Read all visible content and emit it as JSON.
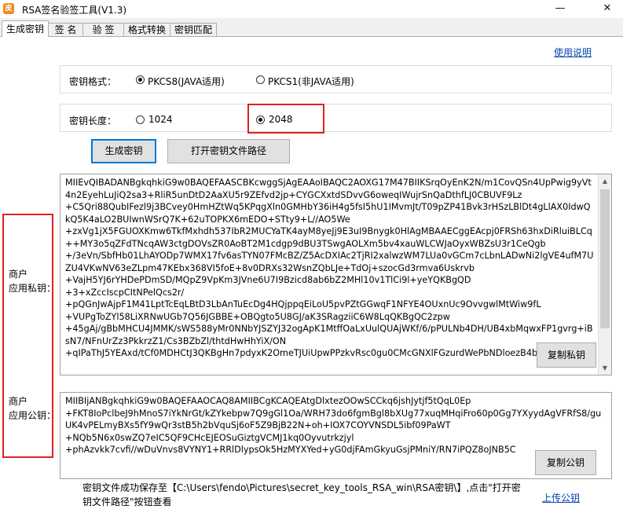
{
  "window": {
    "title": "RSA签名验签工具(V1.3)",
    "app_icon_glyph": "皮",
    "minimize_glyph": "—",
    "close_glyph": "✕"
  },
  "tabs": [
    {
      "label": "生成密钥",
      "active": true
    },
    {
      "label": "签 名",
      "active": false
    },
    {
      "label": "验 签",
      "active": false
    },
    {
      "label": "格式转换",
      "active": false
    },
    {
      "label": "密钥匹配",
      "active": false
    }
  ],
  "help_link": "使用说明",
  "key_format": {
    "label": "密钥格式：",
    "options": [
      {
        "label": "PKCS8(JAVA适用)",
        "checked": true
      },
      {
        "label": "PKCS1(非JAVA适用)",
        "checked": false
      }
    ]
  },
  "key_length": {
    "label": "密钥长度：",
    "options": [
      {
        "label": "1024",
        "checked": false
      },
      {
        "label": "2048",
        "checked": true
      }
    ]
  },
  "buttons": {
    "generate": "生成密钥",
    "open_path": "打开密钥文件路径",
    "copy_private": "复制私钥",
    "copy_public": "复制公钥"
  },
  "private_key": {
    "side_label_line1": "商户",
    "side_label_line2": "应用私钥：",
    "text": "MIIEvQIBADANBgkqhkiG9w0BAQEFAASCBKcwggSjAgEAAoIBAQC2AOXG17M47BIIKSrqOyEnK2N/m1CovQSn4UpPwig9yVt4n2EyehLuJiQ2sa3+RliR5unDtD2AaXU5r9ZEfvd2jp+CYGCXxtdSDvvG6oweqIWujrSnQaDthfLJ0CBUVF9Lz\n+C5Qri88QubIFezl9j3BCvey0HmHZtWq5KPqgXln0GMHbY36iH4g5fsI5hU1IMvmJt/T09pZP41Bvk3rHSzLBlDt4gLlAX0IdwQkQ5K4aLO2BUIwnWSrQ7K+62uTOPKX6mEDO+STty9+L//AO5We\n+zxVg1jX5FGUOXKmw6TkfMxhdh537IbR2MUCYaTK4ayM8yeJj9E3uI9Bnygk0HlAgMBAAECggEAcpj0FRSh63hxDiRluiBLCq++MY3o5qZFdTNcqAW3ctgDOVsZR0AoBT2M1cdgp9dBU3TSwgAOLXm5bv4xauWLCWJaOyxWBZsU3r1CeQgb\n+/3eVn/SbfHb01LhAYODp7WMX17fv6asTYN07FMcBZ/Z5AcDXIAc2TjRI2xalwzWM7LUa0vGCm7cLbnLADwNi2lgVE4ufM7UZU4VKwNV63eZLpm47KEbx368VI5foE+8v0DRXs32WsnZQbLJe+TdOj+szocGd3rmva6Uskrvb\n+VajH5YJ6rYHDePDmSD/MQpZ9VpKm3JVne6U7I9Bzicd8ab6bZ2MHl10v1TlCi9l+yeYQKBgQD\n+3+xZccIscpCItNPelQcs2r/\n+pQGnJwAjpF1M41LptTcEqLBtD3LbAnTuEcDg4HQjppqEiLoU5pvPZtGGwqF1NFYE4OUxnUc9OvvgwlMtWiw9fL\n+VUPgToZYl58LiXRNwUGb7Q56JGBBE+OBQgto5U8GJ/aK3SRagziiC6W8LqQKBgQC2zpw\n+45gAj/gBbMHCU4JMMK/sWS588yMr0NNbYJSZYJ32ogApK1MtffOaLxUulQUAjWKf/6/pPULNb4DH/UB4xbMqwxFP1gvrg+iBsN7/NFnUrZz3PkkrzZ1/Cs3BZbZl/thtdHwHhYiX/ON\n+qIPaThJ5YEAxd/tCf0MDHCtJ3QKBgHn7pdyxK2OmeTJUiUpwPPzkvRsc0gu0CMcGNXlFGzurdWePbNDloezB4bG7G8"
  },
  "public_key": {
    "side_label_line1": "商户",
    "side_label_line2": "应用公钥：",
    "text": "MIIBIjANBgkqhkiG9w0BAQEFAAOCAQ8AMIIBCgKCAQEAtgDlxtezOOwSCCkq6jshJytjf5tQqL0Ep\n+FKT8IoPclbeJ9hMnoS7iYkNrGt/kZYkebpw7Q9gGl1Oa/WRH73do6fgmBgl8bXUg77xuqMHqiFro60p0Gg7YXyydAgVFRfS8/guUK4vPELmyBXs5fY9wQr3stB5h2bVquSj6oF5Z9BjB22N+oh+IOX7COYVNSDL5ibf09PaWT\n+NQb5N6x0swZQ7eIC5QF9CHcEJEOSuGiztgVCMJ1kq0Oyvutrkzjyl\n+phAzvkk7cvfi//wDuVnvs8VYNY1+RRlDlypsOk5HzMYXYed+yG0djFAmGkyuGsjPMniY/RN7iPQZ8oJNB5C"
  },
  "status": {
    "text": "密钥文件成功保存至【C:\\Users\\fendo\\Pictures\\secret_key_tools_RSA_win\\RSA密钥\\】,点击\"打开密钥文件路径\"按钮查看"
  },
  "upload_link": "上传公钥"
}
